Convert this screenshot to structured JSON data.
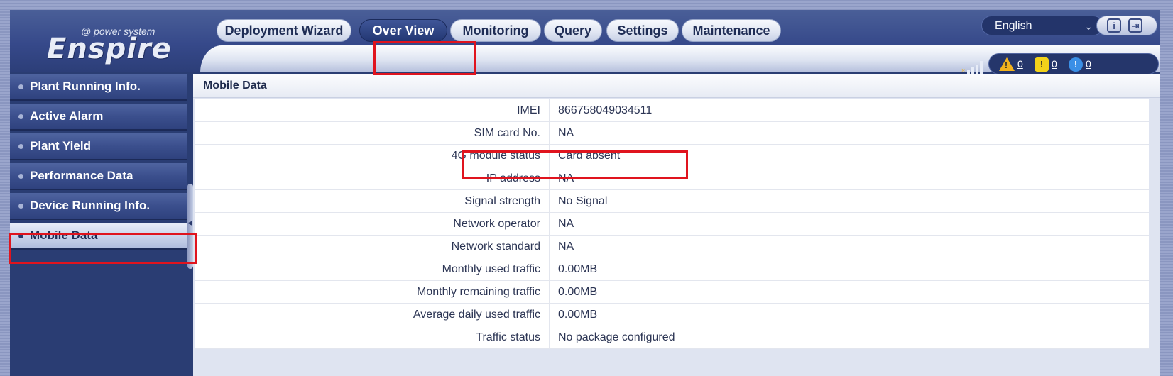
{
  "app": {
    "logo_tagline": "@ power system",
    "logo_brand": "Enspire"
  },
  "header": {
    "language": "English",
    "info_icon": "info-icon",
    "logout_icon": "logout-icon"
  },
  "nav": {
    "tabs": [
      {
        "label": "Deployment Wizard",
        "active": false
      },
      {
        "label": "Over View",
        "active": true
      },
      {
        "label": "Monitoring",
        "active": false
      },
      {
        "label": "Query",
        "active": false
      },
      {
        "label": "Settings",
        "active": false
      },
      {
        "label": "Maintenance",
        "active": false
      }
    ]
  },
  "alarms": {
    "major": "0",
    "minor": "0",
    "warning": "0"
  },
  "sidebar": {
    "items": [
      {
        "label": "Plant Running Info.",
        "active": false
      },
      {
        "label": "Active Alarm",
        "active": false
      },
      {
        "label": "Plant Yield",
        "active": false
      },
      {
        "label": "Performance Data",
        "active": false
      },
      {
        "label": "Device Running Info.",
        "active": false
      },
      {
        "label": "Mobile Data",
        "active": true
      }
    ]
  },
  "panel": {
    "title": "Mobile Data",
    "rows": [
      {
        "key": "IMEI",
        "value": "866758049034511"
      },
      {
        "key": "SIM card No.",
        "value": "NA"
      },
      {
        "key": "4G module status",
        "value": "Card absent"
      },
      {
        "key": "IP address",
        "value": "NA"
      },
      {
        "key": "Signal strength",
        "value": "No Signal"
      },
      {
        "key": "Network operator",
        "value": "NA"
      },
      {
        "key": "Network standard",
        "value": "NA"
      },
      {
        "key": "Monthly used traffic",
        "value": "0.00MB"
      },
      {
        "key": "Monthly remaining traffic",
        "value": "0.00MB"
      },
      {
        "key": "Average daily used traffic",
        "value": "0.00MB"
      },
      {
        "key": "Traffic status",
        "value": "No package configured"
      }
    ]
  },
  "colors": {
    "highlight": "#e0141e",
    "accent": "#233773"
  }
}
